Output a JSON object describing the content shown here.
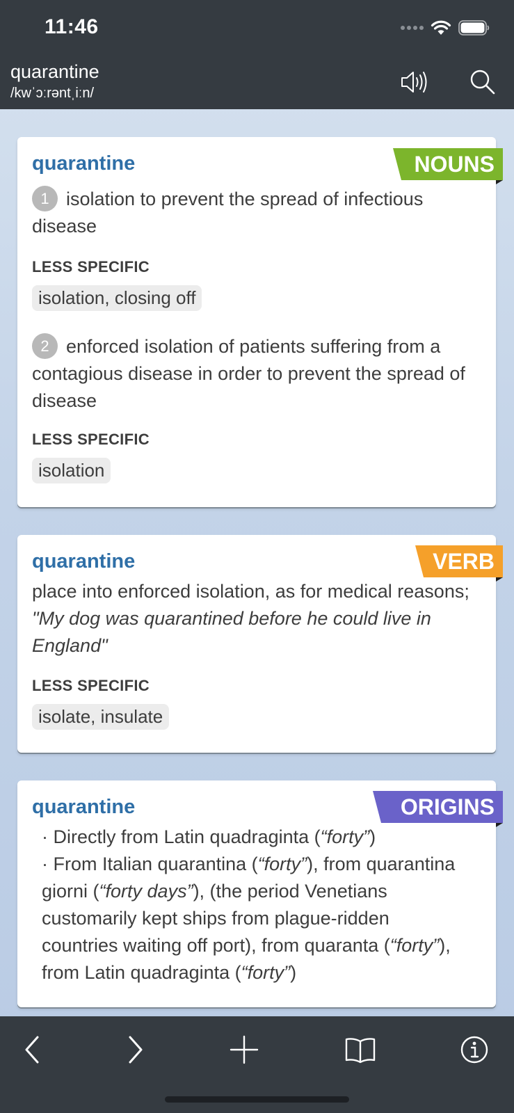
{
  "status": {
    "time": "11:46"
  },
  "header": {
    "word": "quarantine",
    "pronunciation": "/kwˈɔːrəntˌiːn/"
  },
  "noun_card": {
    "word": "quarantine",
    "tag": "NOUNS",
    "tag_color": "#7cb52c",
    "senses": [
      {
        "number": "1",
        "definition": "isolation to prevent the spread of infectious disease",
        "less_specific_label": "LESS SPECIFIC",
        "less_specific": "isolation, closing off"
      },
      {
        "number": "2",
        "definition": "enforced isolation of patients suffering from a contagious disease in order to prevent the spread of disease",
        "less_specific_label": "LESS SPECIFIC",
        "less_specific": "isolation"
      }
    ]
  },
  "verb_card": {
    "word": "quarantine",
    "tag": "VERB",
    "tag_color": "#f5a02a",
    "definition": "place into enforced isolation, as for medical reasons;",
    "example": "\"My dog was quarantined before he could live in England\"",
    "less_specific_label": "LESS SPECIFIC",
    "less_specific": "isolate, insulate"
  },
  "origins_card": {
    "word": "quarantine",
    "tag": "ORIGINS",
    "tag_color": "#6a62c9",
    "line1_pre": "· Directly from Latin quadraginta (",
    "line1_it": "“forty”",
    "line1_post": ")",
    "line2_a": "· From Italian quarantina (",
    "line2_b": "“forty”",
    "line2_c": "), from quarantina giorni (",
    "line2_d": "“forty days”",
    "line2_e": "), (the period Venetians customarily kept ships from plague-ridden countries waiting off port), from quaranta (",
    "line2_f": "“forty”",
    "line2_g": "), from Latin quadraginta (",
    "line2_h": "“forty”",
    "line2_i": ")"
  },
  "toolbar": {
    "icons": [
      "back-icon",
      "forward-icon",
      "add-icon",
      "bookmarks-icon",
      "info-icon"
    ]
  }
}
